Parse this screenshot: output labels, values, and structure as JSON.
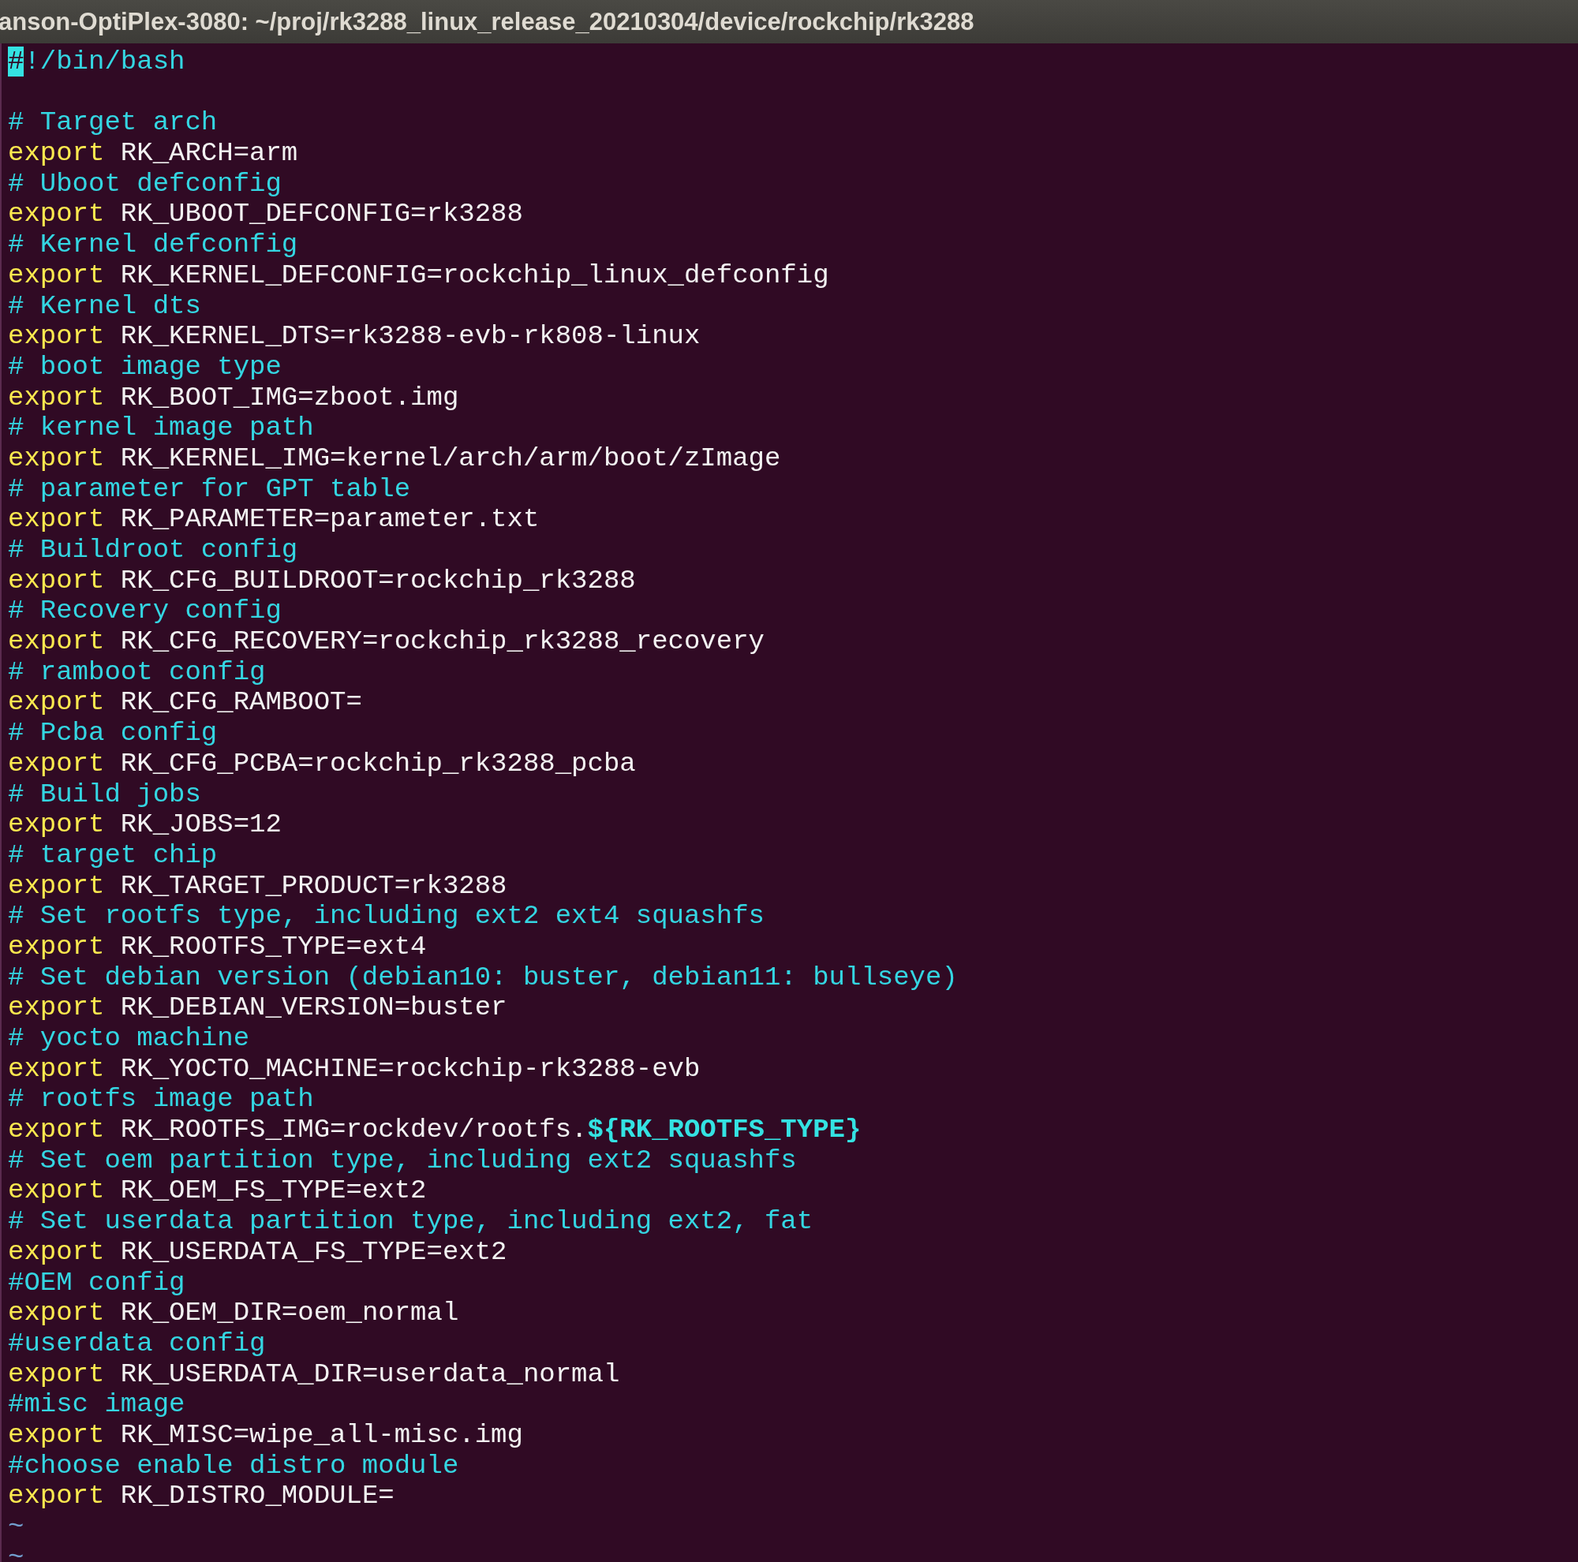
{
  "window": {
    "title": "anson-OptiPlex-3080: ~/proj/rk3288_linux_release_20210304/device/rockchip/rk3288"
  },
  "lines": [
    {
      "kind": "shebang",
      "cursor": "#",
      "text": "!/bin/bash"
    },
    {
      "kind": "blank"
    },
    {
      "kind": "comment",
      "text": "# Target arch"
    },
    {
      "kind": "export",
      "keyword": "export",
      "text": "RK_ARCH=arm"
    },
    {
      "kind": "comment",
      "text": "# Uboot defconfig"
    },
    {
      "kind": "export",
      "keyword": "export",
      "text": "RK_UBOOT_DEFCONFIG=rk3288"
    },
    {
      "kind": "comment",
      "text": "# Kernel defconfig"
    },
    {
      "kind": "export",
      "keyword": "export",
      "text": "RK_KERNEL_DEFCONFIG=rockchip_linux_defconfig"
    },
    {
      "kind": "comment",
      "text": "# Kernel dts"
    },
    {
      "kind": "export",
      "keyword": "export",
      "text": "RK_KERNEL_DTS=rk3288-evb-rk808-linux"
    },
    {
      "kind": "comment",
      "text": "# boot image type"
    },
    {
      "kind": "export",
      "keyword": "export",
      "text": "RK_BOOT_IMG=zboot.img"
    },
    {
      "kind": "comment",
      "text": "# kernel image path"
    },
    {
      "kind": "export",
      "keyword": "export",
      "text": "RK_KERNEL_IMG=kernel/arch/arm/boot/zImage"
    },
    {
      "kind": "comment",
      "text": "# parameter for GPT table"
    },
    {
      "kind": "export",
      "keyword": "export",
      "text": "RK_PARAMETER=parameter.txt"
    },
    {
      "kind": "comment",
      "text": "# Buildroot config"
    },
    {
      "kind": "export",
      "keyword": "export",
      "text": "RK_CFG_BUILDROOT=rockchip_rk3288"
    },
    {
      "kind": "comment",
      "text": "# Recovery config"
    },
    {
      "kind": "export",
      "keyword": "export",
      "text": "RK_CFG_RECOVERY=rockchip_rk3288_recovery"
    },
    {
      "kind": "comment",
      "text": "# ramboot config"
    },
    {
      "kind": "export",
      "keyword": "export",
      "text": "RK_CFG_RAMBOOT="
    },
    {
      "kind": "comment",
      "text": "# Pcba config"
    },
    {
      "kind": "export",
      "keyword": "export",
      "text": "RK_CFG_PCBA=rockchip_rk3288_pcba"
    },
    {
      "kind": "comment",
      "text": "# Build jobs"
    },
    {
      "kind": "export",
      "keyword": "export",
      "text": "RK_JOBS=12"
    },
    {
      "kind": "comment",
      "text": "# target chip"
    },
    {
      "kind": "export",
      "keyword": "export",
      "text": "RK_TARGET_PRODUCT=rk3288"
    },
    {
      "kind": "comment",
      "text": "# Set rootfs type, including ext2 ext4 squashfs"
    },
    {
      "kind": "export",
      "keyword": "export",
      "text": "RK_ROOTFS_TYPE=ext4"
    },
    {
      "kind": "comment",
      "text": "# Set debian version (debian10: buster, debian11: bullseye)"
    },
    {
      "kind": "export",
      "keyword": "export",
      "text": "RK_DEBIAN_VERSION=buster"
    },
    {
      "kind": "comment",
      "text": "# yocto machine"
    },
    {
      "kind": "export",
      "keyword": "export",
      "text": "RK_YOCTO_MACHINE=rockchip-rk3288-evb"
    },
    {
      "kind": "comment",
      "text": "# rootfs image path"
    },
    {
      "kind": "export",
      "keyword": "export",
      "text": "RK_ROOTFS_IMG=rockdev/rootfs.",
      "expansion": "${RK_ROOTFS_TYPE}"
    },
    {
      "kind": "comment",
      "text": "# Set oem partition type, including ext2 squashfs"
    },
    {
      "kind": "export",
      "keyword": "export",
      "text": "RK_OEM_FS_TYPE=ext2"
    },
    {
      "kind": "comment",
      "text": "# Set userdata partition type, including ext2, fat"
    },
    {
      "kind": "export",
      "keyword": "export",
      "text": "RK_USERDATA_FS_TYPE=ext2"
    },
    {
      "kind": "comment",
      "text": "#OEM config"
    },
    {
      "kind": "export",
      "keyword": "export",
      "text": "RK_OEM_DIR=oem_normal"
    },
    {
      "kind": "comment",
      "text": "#userdata config"
    },
    {
      "kind": "export",
      "keyword": "export",
      "text": "RK_USERDATA_DIR=userdata_normal"
    },
    {
      "kind": "comment",
      "text": "#misc image"
    },
    {
      "kind": "export",
      "keyword": "export",
      "text": "RK_MISC=wipe_all-misc.img"
    },
    {
      "kind": "comment",
      "text": "#choose enable distro module"
    },
    {
      "kind": "export",
      "keyword": "export",
      "text": "RK_DISTRO_MODULE="
    },
    {
      "kind": "tilde",
      "text": "~"
    },
    {
      "kind": "tilde",
      "text": "~"
    }
  ]
}
